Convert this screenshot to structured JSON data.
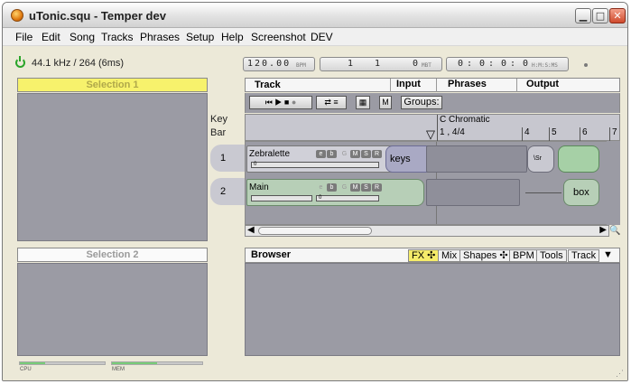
{
  "window": {
    "title": "uTonic.squ - Temper dev",
    "minimize": "▁",
    "maximize": "□",
    "close": "✕"
  },
  "menu": [
    "File",
    "Edit",
    "Song",
    "Tracks",
    "Phrases",
    "Setup",
    "Help",
    "Screenshot",
    "DEV"
  ],
  "status": {
    "sample_rate": "44.1 kHz / 264 (6ms)"
  },
  "transport": {
    "tempo": "120.00",
    "tempo_unit": "BPM",
    "position_a": "1",
    "position_b": "1",
    "position_c": "0",
    "position_unit": "MBT",
    "time_h": "0",
    "time_m": "0",
    "time_s": "0",
    "time_ms": "0",
    "time_unit": "H:M:S:MS"
  },
  "selection1": {
    "title": "Selection 1"
  },
  "selection2": {
    "title": "Selection 2"
  },
  "meters": {
    "cpu_label": "CPU",
    "mem_label": "MEM",
    "cpu_level": 0.3,
    "mem_level": 0.5
  },
  "columns": {
    "track": "Track",
    "input": "Input",
    "phrases": "Phrases",
    "output": "Output"
  },
  "toolbar": {
    "m_label": "M",
    "groups_label": "Groups:"
  },
  "key_label": "Key",
  "bar_label": "Bar",
  "ruler": {
    "key": "C Chromatic",
    "time_sig": "1 , 4/4",
    "bars": [
      "4",
      "5",
      "6",
      "7"
    ]
  },
  "tracks": [
    {
      "number": "1",
      "name": "Zebralette",
      "slider_a": "0",
      "input_label": "keys",
      "output_label": "\\Sr"
    },
    {
      "number": "2",
      "name": "Main",
      "slider_a": "0",
      "output_label": "box"
    }
  ],
  "track_buttons": [
    "e",
    "b",
    "G",
    "M",
    "S",
    "R"
  ],
  "browser": {
    "title": "Browser",
    "tabs": [
      "FX ✣",
      "Mix",
      "Shapes ✣",
      "BPM",
      "Tools",
      "Track"
    ],
    "menu": "▼"
  },
  "scroll": {
    "left": "◀",
    "right": "▶"
  }
}
